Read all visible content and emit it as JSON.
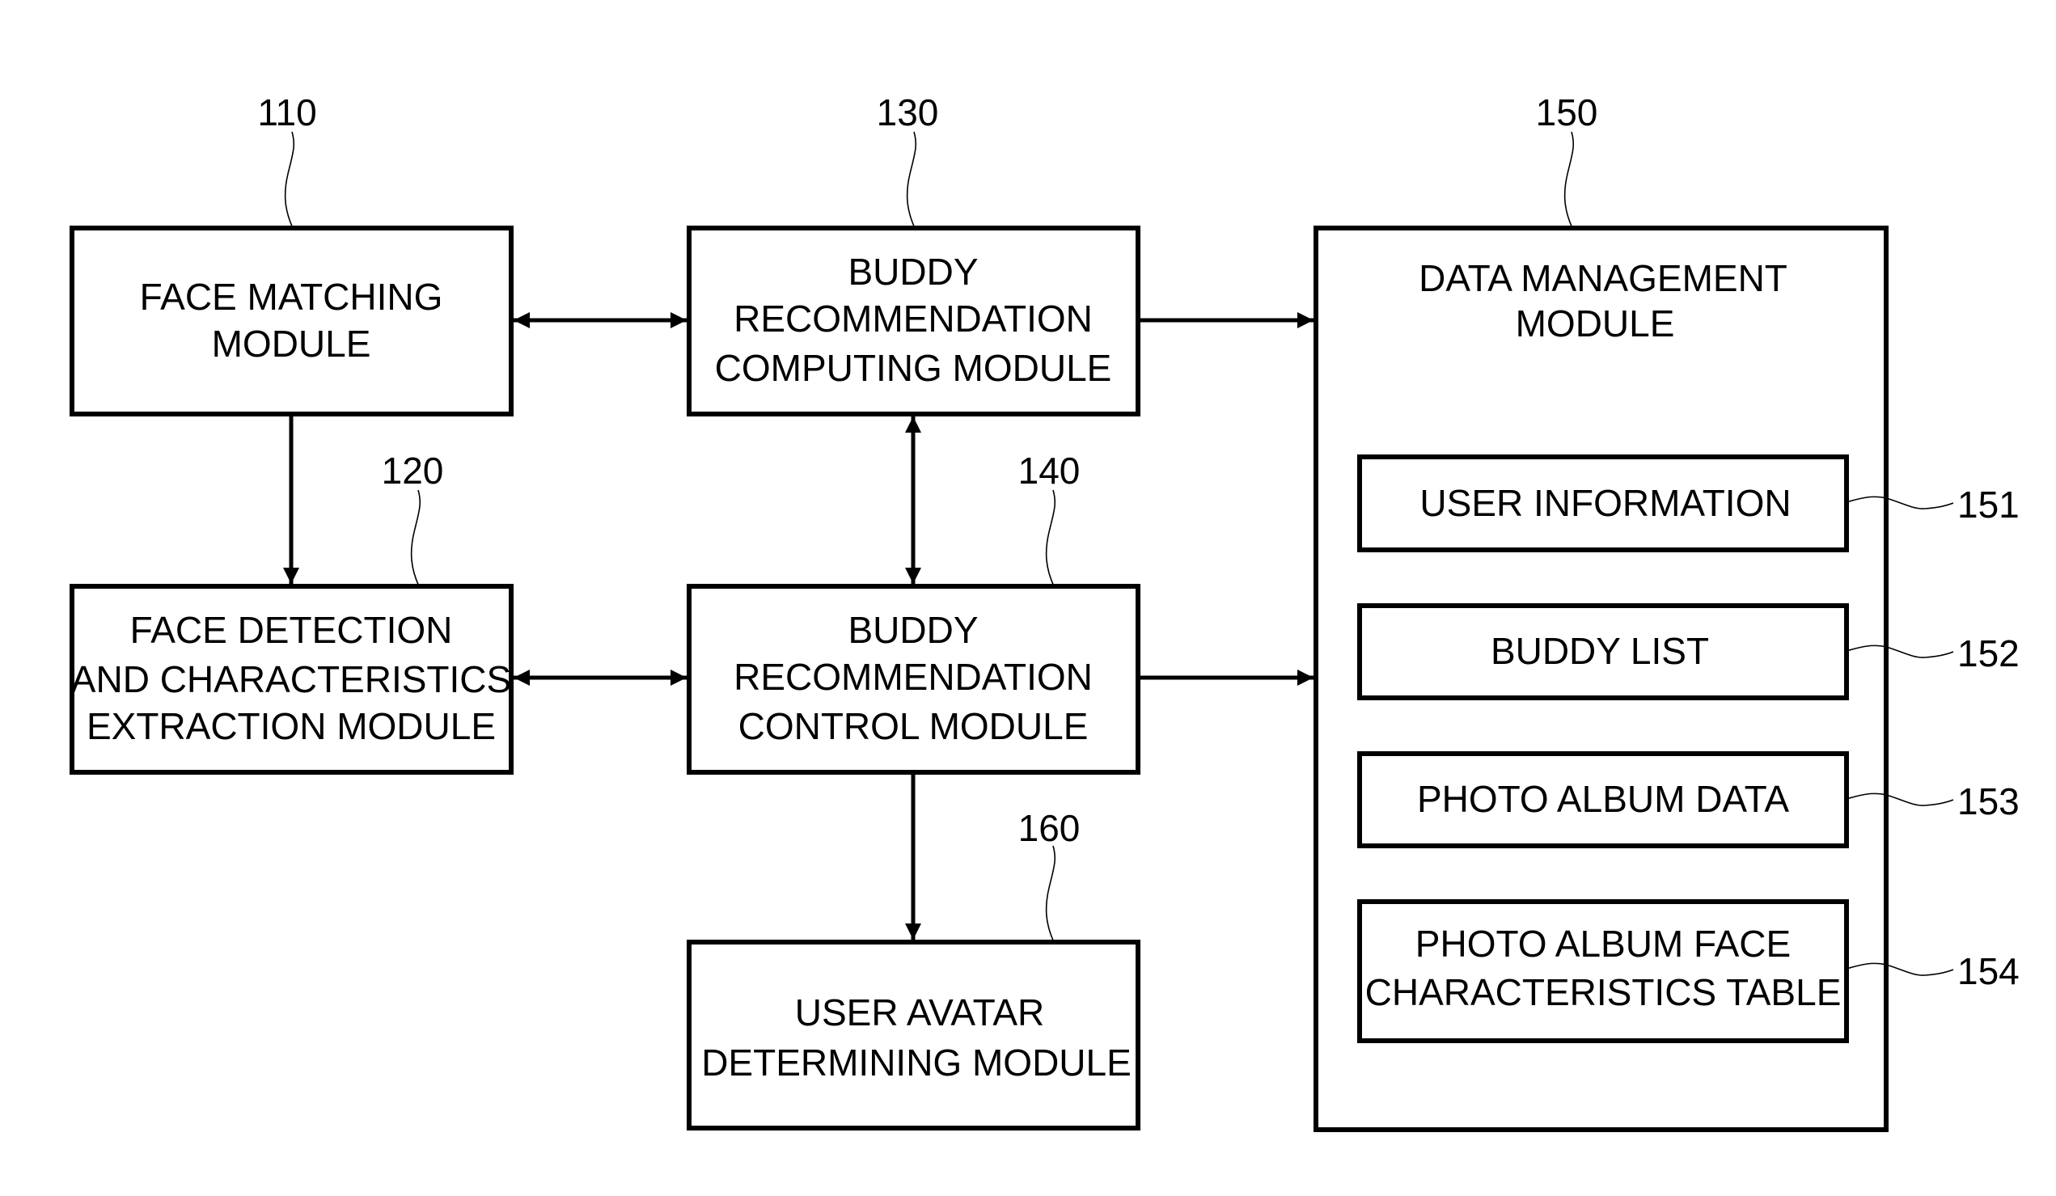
{
  "diagram": {
    "type": "block-diagram",
    "modules": [
      {
        "id": "110",
        "ref": "110",
        "lines": [
          "FACE MATCHING",
          "MODULE"
        ]
      },
      {
        "id": "120",
        "ref": "120",
        "lines": [
          "FACE DETECTION",
          "AND CHARACTERISTICS",
          "EXTRACTION MODULE"
        ]
      },
      {
        "id": "130",
        "ref": "130",
        "lines": [
          "BUDDY",
          "RECOMMENDATION",
          "COMPUTING MODULE"
        ]
      },
      {
        "id": "140",
        "ref": "140",
        "lines": [
          "BUDDY",
          "RECOMMENDATION",
          "CONTROL MODULE"
        ]
      },
      {
        "id": "160",
        "ref": "160",
        "lines": [
          "USER AVATAR",
          "DETERMINING MODULE"
        ]
      },
      {
        "id": "150",
        "ref": "150",
        "lines": [
          "DATA MANAGEMENT",
          "MODULE"
        ]
      }
    ],
    "data_items": [
      {
        "id": "151",
        "ref": "151",
        "lines": [
          "USER INFORMATION"
        ]
      },
      {
        "id": "152",
        "ref": "152",
        "lines": [
          "BUDDY LIST"
        ]
      },
      {
        "id": "153",
        "ref": "153",
        "lines": [
          "PHOTO ALBUM DATA"
        ]
      },
      {
        "id": "154",
        "ref": "154",
        "lines": [
          "PHOTO ALBUM FACE",
          "CHARACTERISTICS TABLE"
        ]
      }
    ],
    "connections": [
      {
        "from": "110",
        "to": "130",
        "direction": "bidirectional"
      },
      {
        "from": "110",
        "to": "120",
        "direction": "forward"
      },
      {
        "from": "130",
        "to": "140",
        "direction": "bidirectional"
      },
      {
        "from": "130",
        "to": "150",
        "direction": "forward"
      },
      {
        "from": "120",
        "to": "140",
        "direction": "bidirectional"
      },
      {
        "from": "140",
        "to": "150",
        "direction": "forward"
      },
      {
        "from": "140",
        "to": "160",
        "direction": "forward"
      }
    ]
  }
}
